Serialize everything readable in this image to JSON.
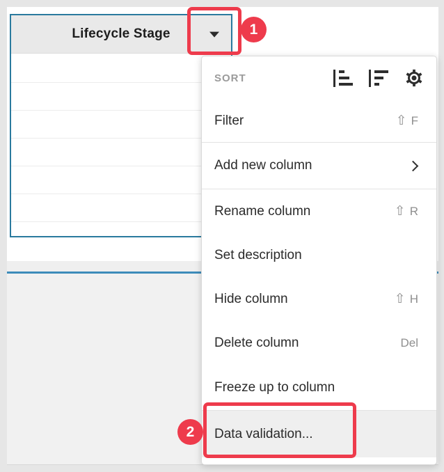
{
  "table": {
    "selected_column_header": "Lifecycle Stage"
  },
  "menu": {
    "sort_section_label": "SORT",
    "filter": {
      "label": "Filter",
      "modifier": "⇧",
      "key": "F"
    },
    "add_new_column": {
      "label": "Add new column"
    },
    "rename_column": {
      "label": "Rename column",
      "modifier": "⇧",
      "key": "R"
    },
    "set_description": {
      "label": "Set description"
    },
    "hide_column": {
      "label": "Hide column",
      "modifier": "⇧",
      "key": "H"
    },
    "delete_column": {
      "label": "Delete column",
      "key": "Del"
    },
    "freeze_up_to_column": {
      "label": "Freeze up to column"
    },
    "data_validation": {
      "label": "Data validation..."
    }
  },
  "annotations": {
    "step_1_label": "1",
    "step_2_label": "2",
    "highlight_color": "#ee3b4c"
  },
  "colors": {
    "selection_border": "#2a7a9e",
    "section_divider_line": "#3d8cba",
    "header_background": "#e9e9e9",
    "menu_hover_background": "#efefef"
  }
}
